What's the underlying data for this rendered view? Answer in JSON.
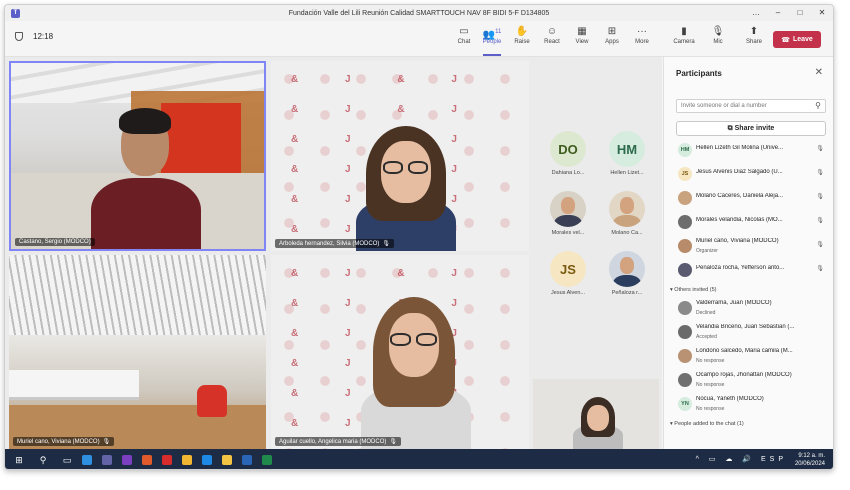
{
  "window": {
    "title": "Fundación Valle del Lili Reunión Calidad SMARTTOUCH NAV 8F BIDI 5-F D134805",
    "controls": [
      "…",
      "–",
      "□",
      "✕"
    ]
  },
  "toolbar": {
    "timer": "12:18",
    "buttons": [
      {
        "label": "Chat",
        "icon": "chat-icon",
        "glyph": "▭"
      },
      {
        "label": "People",
        "icon": "people-icon",
        "glyph": "👥",
        "count": "11",
        "active": true
      },
      {
        "label": "Raise",
        "icon": "raise-hand-icon",
        "glyph": "✋"
      },
      {
        "label": "React",
        "icon": "react-icon",
        "glyph": "☺"
      },
      {
        "label": "View",
        "icon": "view-icon",
        "glyph": "▦"
      },
      {
        "label": "Apps",
        "icon": "apps-icon",
        "glyph": "⊞"
      },
      {
        "label": "More",
        "icon": "more-icon",
        "glyph": "···"
      },
      {
        "label": "Camera",
        "icon": "camera-icon",
        "glyph": "▮"
      },
      {
        "label": "Mic",
        "icon": "mic-off-icon",
        "glyph": "🎙"
      },
      {
        "label": "Share",
        "icon": "share-icon",
        "glyph": "⬆"
      }
    ],
    "leave_label": "Leave"
  },
  "videos": [
    {
      "name": "Castano, Sergio (MODCO)"
    },
    {
      "name": "Arboleda hernandez, Silvia (MODCO)"
    },
    {
      "name": "Muriel cano, Viviana (MODCO)"
    },
    {
      "name": "Aguilar cuello, Angelica maria (MODCO)"
    }
  ],
  "pattern_glyphs": "& J & J & J & J & J & J & J & J & J & J & J & J & J & J & J & J & J & J & J & J &",
  "avatars": [
    {
      "initials": "DO",
      "label": "Dahiana Lo...",
      "bg": "#dde8d0",
      "fg": "#3e5c1e"
    },
    {
      "initials": "HM",
      "label": "Hellen Lizet...",
      "bg": "#d5ecdf",
      "fg": "#2c6b4a"
    },
    {
      "initials": "",
      "label": "Morales vel...",
      "photo": true
    },
    {
      "initials": "",
      "label": "Molano Ca...",
      "photo": true
    },
    {
      "initials": "JS",
      "label": "Jesus Alven...",
      "bg": "#f6e6c2",
      "fg": "#7a5a10"
    },
    {
      "initials": "",
      "label": "Peñaloza r...",
      "photo": true
    }
  ],
  "panel": {
    "title": "Participants",
    "search_placeholder": "Invite someone or dial a number",
    "share_label": "Share invite",
    "participants": [
      {
        "name": "Hellen Lizeth Gil Molina (Unive...",
        "initials": "HM",
        "bg": "#d5ecdf",
        "fg": "#2c6b4a"
      },
      {
        "name": "Jesus Alvenis Diaz Salgado (U...",
        "initials": "JS",
        "bg": "#f6e6c2",
        "fg": "#7a5a10"
      },
      {
        "name": "Molano Caceres, Daniela Aleja...",
        "initials": "",
        "bg": "#c9a27e",
        "fg": "#fff"
      },
      {
        "name": "Morales velandia, Nicolas (MO...",
        "initials": "",
        "bg": "#6d6d6d",
        "fg": "#fff"
      },
      {
        "name": "Muriel cano, Viviana (MODCO)",
        "sub": "Organizer",
        "initials": "",
        "bg": "#b88b6a",
        "fg": "#fff"
      },
      {
        "name": "Peñaloza rocha, Yefferson anto...",
        "initials": "",
        "bg": "#5a5a70",
        "fg": "#fff"
      }
    ],
    "others_section": "Others invited (5)",
    "others": [
      {
        "name": "Valderrama, Juan (MODCO)",
        "sub": "Declined",
        "initials": "",
        "bg": "#8a8a8a"
      },
      {
        "name": "Velandia Briceño, Juan Sebastian (...",
        "sub": "Accepted",
        "initials": "",
        "bg": "#6b6b6b"
      },
      {
        "name": "Londoño salcedo, Maria camila (M...",
        "sub": "No response",
        "initials": "",
        "bg": "#b99274"
      },
      {
        "name": "Ocampo rojas, Jhonattan (MODCO)",
        "sub": "No response",
        "initials": "",
        "bg": "#707070"
      },
      {
        "name": "Nocua, Yaneth (MODCO)",
        "sub": "No response",
        "initials": "YN",
        "bg": "#d5ecdf",
        "fg": "#2c6b4a"
      }
    ],
    "added_section": "People added to the chat (1)"
  },
  "taskbar": {
    "time": "9:12 a. m.",
    "date": "20/06/2024",
    "lang": "ESP"
  }
}
